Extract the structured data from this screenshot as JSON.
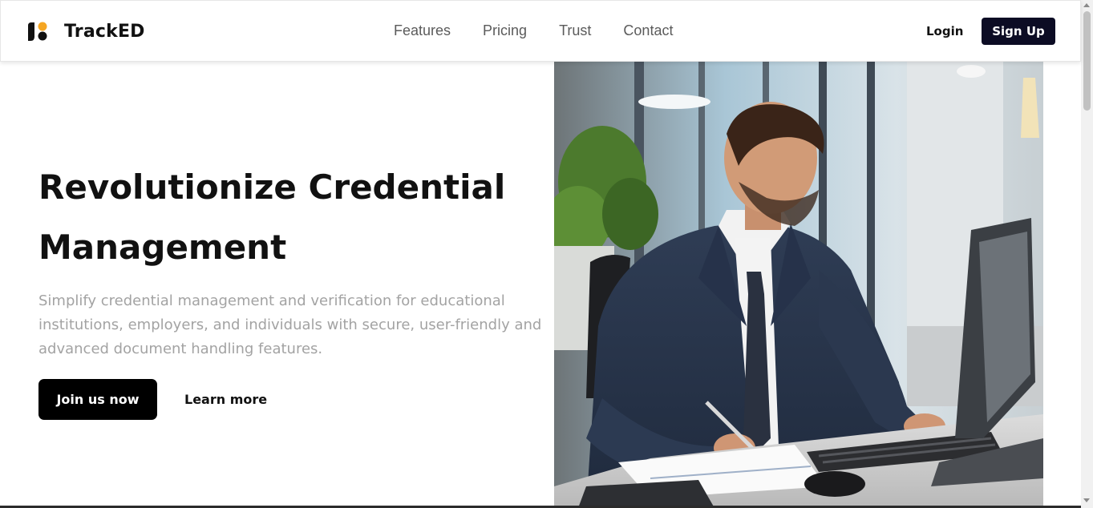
{
  "brand": {
    "name": "TrackED"
  },
  "nav": {
    "links": [
      {
        "label": "Features"
      },
      {
        "label": "Pricing"
      },
      {
        "label": "Trust"
      },
      {
        "label": "Contact"
      }
    ],
    "login_label": "Login",
    "signup_label": "Sign Up"
  },
  "hero": {
    "title": "Revolutionize Credential Management",
    "subtitle": "Simplify credential management and verification for educational institutions, employers, and individuals with secure, user-friendly and advanced document handling features.",
    "primary_cta": "Join us now",
    "secondary_cta": "Learn more"
  },
  "colors": {
    "brand_dark": "#0c0c24",
    "logo_accent": "#f5a623",
    "subtitle_gray": "#a3a3a3"
  }
}
